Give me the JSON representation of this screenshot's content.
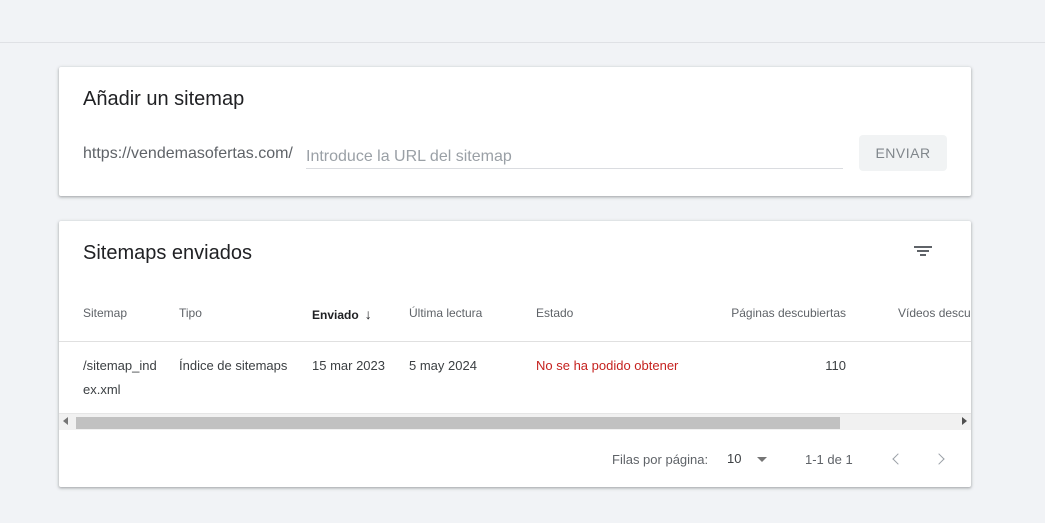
{
  "add_sitemap": {
    "title": "Añadir un sitemap",
    "url_prefix": "https://vendemasofertas.com/",
    "input_placeholder": "Introduce la URL del sitemap",
    "input_value": "",
    "submit_label": "ENVIAR"
  },
  "submitted": {
    "title": "Sitemaps enviados",
    "filter_icon": "filter-list-icon",
    "columns": {
      "sitemap": "Sitemap",
      "tipo": "Tipo",
      "enviado": "Enviado",
      "enviado_sort_icon": "arrow-downward-icon",
      "ultima_lectura": "Última lectura",
      "estado": "Estado",
      "paginas": "Páginas descubiertas",
      "videos": "Vídeos descubiertos"
    },
    "rows": [
      {
        "sitemap": "/sitemap_index.xml",
        "tipo": "Índice de sitemaps",
        "enviado": "15 mar 2023",
        "ultima_lectura": "5 may 2024",
        "estado": "No se ha podido obtener",
        "paginas": "110",
        "videos": ""
      }
    ],
    "colors": {
      "error": "#c5221f"
    },
    "scroll_position_fraction": 0.0,
    "scroll_visible_fraction": 0.87,
    "pagination": {
      "rows_per_page_label": "Filas por página:",
      "rows_per_page_value": "10",
      "range_label": "1-1 de 1",
      "prev_icon": "chevron-left-icon",
      "next_icon": "chevron-right-icon"
    }
  }
}
